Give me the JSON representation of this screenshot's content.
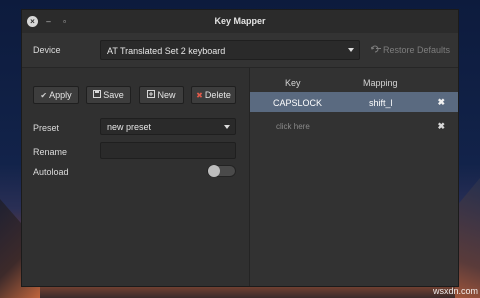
{
  "window": {
    "title": "Key Mapper",
    "controls": {
      "close": "×",
      "minimize": "–",
      "maximize": "▫"
    }
  },
  "device": {
    "label": "Device",
    "selected": "AT Translated Set 2 keyboard",
    "restore_label": "Restore Defaults"
  },
  "toolbar": {
    "apply_label": "Apply",
    "save_label": "Save",
    "new_label": "New",
    "delete_label": "Delete"
  },
  "form": {
    "preset_label": "Preset",
    "preset_value": "new preset",
    "rename_label": "Rename",
    "rename_value": "",
    "autoload_label": "Autoload",
    "autoload_enabled": false
  },
  "mappings": {
    "columns": [
      "Key",
      "Mapping"
    ],
    "rows": [
      {
        "key": "CAPSLOCK",
        "mapping": "shift_l",
        "selected": true
      },
      {
        "key": "click here",
        "mapping": "",
        "selected": false
      }
    ],
    "remove_symbol": "✖"
  },
  "watermark": "wsxdn.com",
  "colors": {
    "selected_row": "#5a6a80",
    "delete_icon": "#e05a4a"
  }
}
